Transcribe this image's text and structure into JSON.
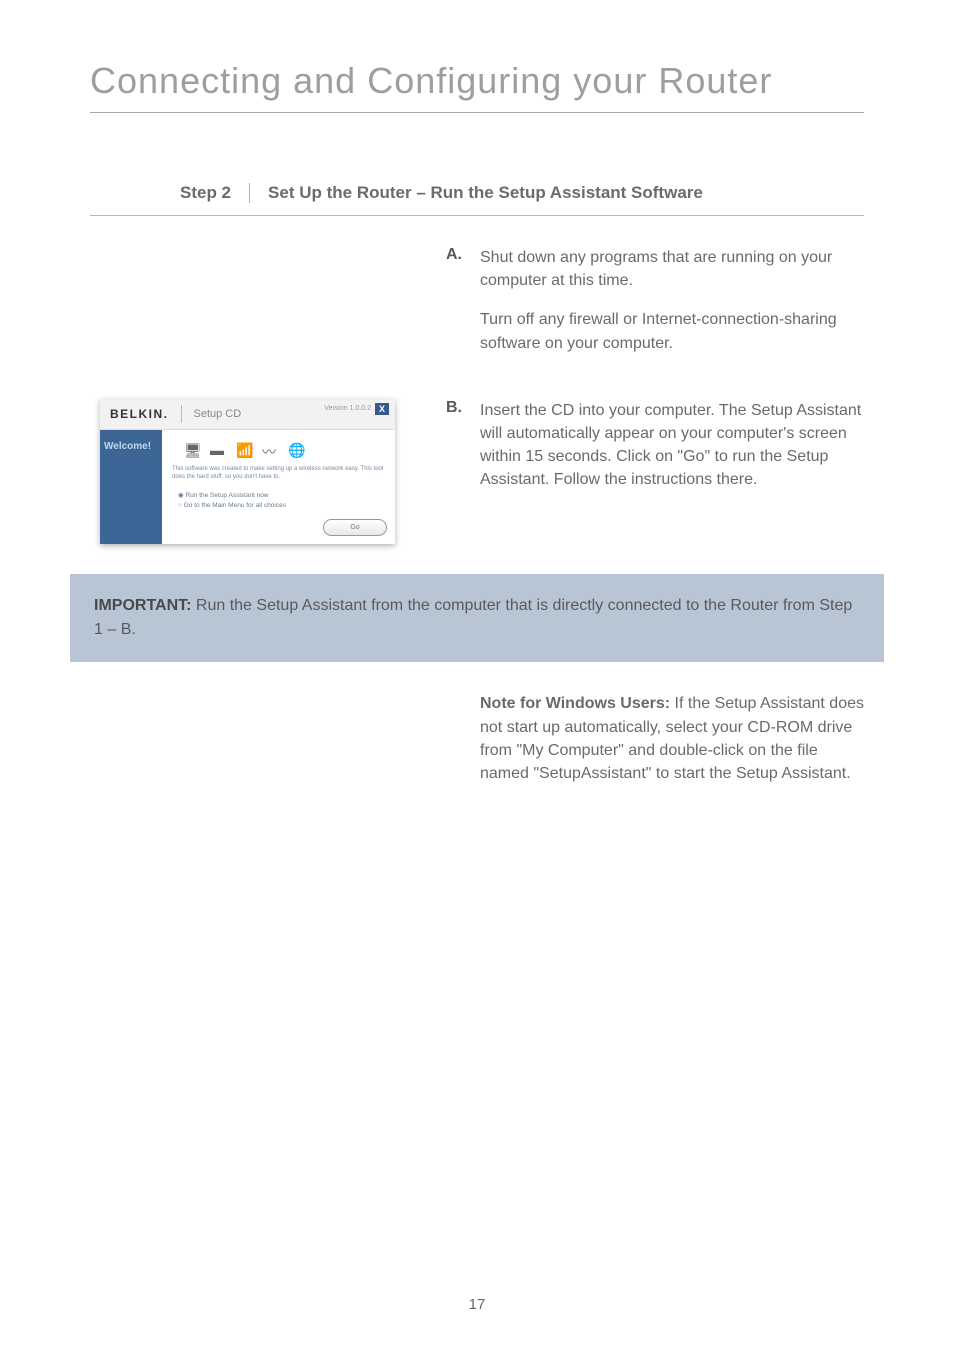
{
  "heading": "Connecting and Configuring your Router",
  "step": {
    "label": "Step 2",
    "title": "Set Up the Router – Run the Setup Assistant Software"
  },
  "itemA": {
    "letter": "A.",
    "p1": "Shut down any programs that are running on your computer at this time.",
    "p2": "Turn off any firewall or Internet-connection-sharing software on your computer."
  },
  "itemB": {
    "letter": "B.",
    "text": "Insert the CD into your computer. The Setup Assistant will automatically appear on your computer's screen within 15 seconds. Click on \"Go\" to run the Setup Assistant. Follow the instructions there."
  },
  "screenshot": {
    "brand": "BELKIN.",
    "title": "Setup CD",
    "version": "Version 1.0.0.2",
    "close": "X",
    "sidebar": "Welcome!",
    "desc": "This software was created to make setting up a wireless network easy. This tool does the hard stuff, so you don't have to.",
    "radio1": "Run the Setup Assistant now",
    "radio2": "Go to the Main Menu for all choices",
    "go": "Go"
  },
  "important": {
    "label": "IMPORTANT:",
    "text": " Run the Setup Assistant from the computer that is directly connected to the Router from Step 1 – B."
  },
  "note": {
    "label": "Note for Windows Users:",
    "text": " If the Setup Assistant does not start up automatically, select your CD-ROM drive from \"My Computer\" and double-click on the file named \"SetupAssistant\" to start the Setup Assistant."
  },
  "pageNumber": "17"
}
